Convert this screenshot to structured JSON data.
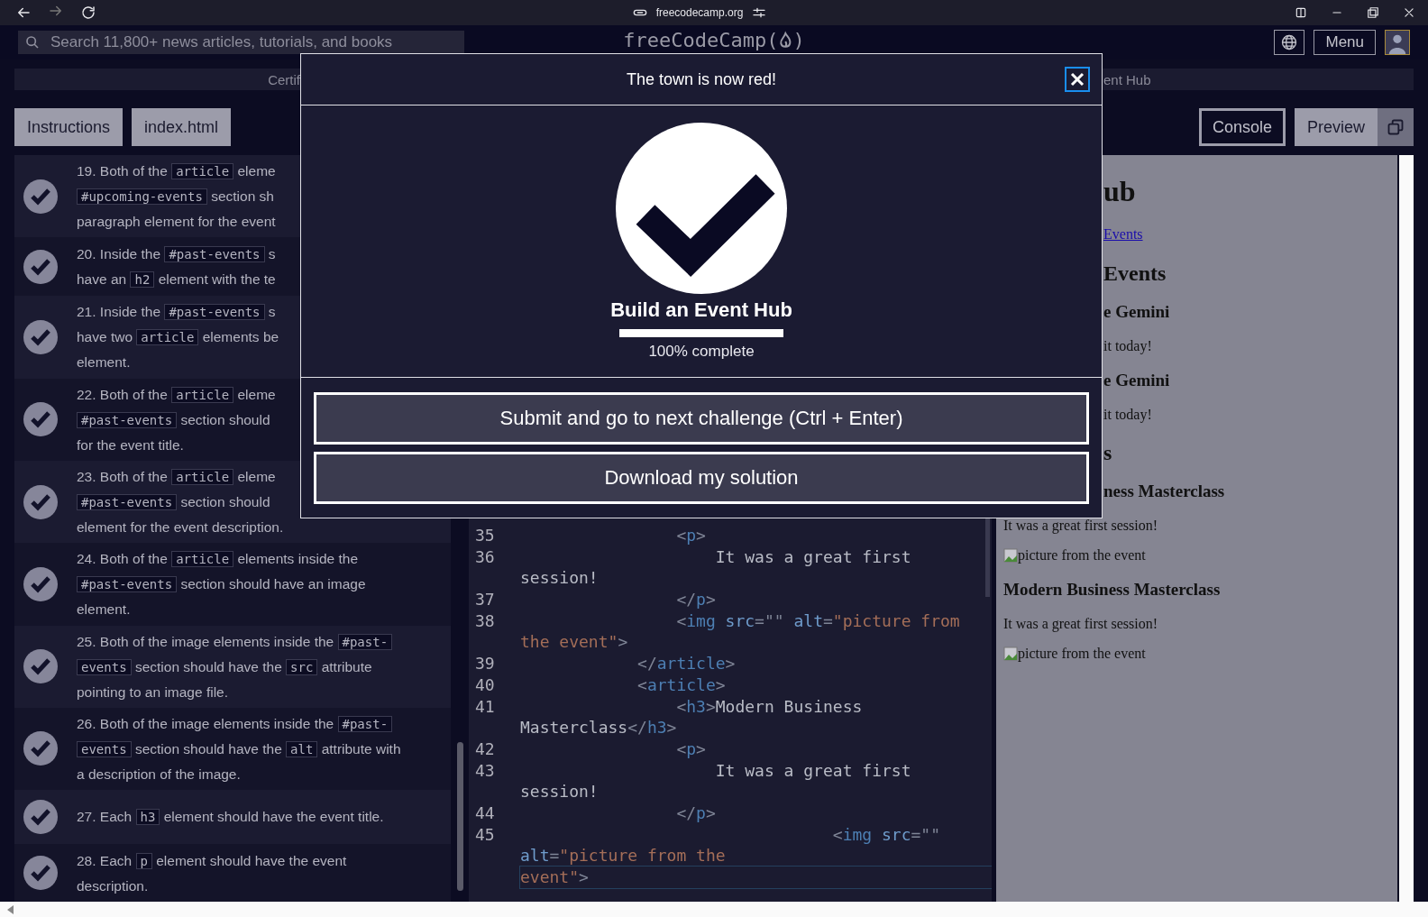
{
  "browser": {
    "url": "freecodecamp.org"
  },
  "nav": {
    "search": {
      "placeholder": "Search 11,800+ news articles, tutorials, and books"
    },
    "logo": {
      "before": "freeCodeCamp(",
      "after": ")"
    },
    "menu": "Menu"
  },
  "breadcrumb": {
    "left": "Certif",
    "right": "ent Hub"
  },
  "toolbar": {
    "tabs": [
      "Instructions",
      "index.html"
    ],
    "console": "Console",
    "preview": "Preview"
  },
  "tests": [
    {
      "passed": true,
      "lines": [
        [
          "19. Both of the ",
          {
            "code": "article"
          },
          " eleme"
        ],
        [
          {
            "code": "#upcoming-events"
          },
          " section sh"
        ],
        [
          "paragraph element for the event"
        ]
      ]
    },
    {
      "passed": true,
      "lines": [
        [
          "20. Inside the ",
          {
            "code": "#past-events"
          },
          " s"
        ],
        [
          "have an ",
          {
            "code": "h2"
          },
          " element with the te"
        ]
      ]
    },
    {
      "passed": true,
      "lines": [
        [
          "21. Inside the ",
          {
            "code": "#past-events"
          },
          " s"
        ],
        [
          "have two ",
          {
            "code": "article"
          },
          " elements be"
        ],
        [
          "element."
        ]
      ]
    },
    {
      "passed": true,
      "lines": [
        [
          "22. Both of the ",
          {
            "code": "article"
          },
          " eleme"
        ],
        [
          {
            "code": "#past-events"
          },
          " section should"
        ],
        [
          "for the event title."
        ]
      ]
    },
    {
      "passed": true,
      "lines": [
        [
          "23. Both of the ",
          {
            "code": "article"
          },
          " eleme"
        ],
        [
          {
            "code": "#past-events"
          },
          " section should"
        ],
        [
          "element for the event description."
        ]
      ]
    },
    {
      "passed": true,
      "lines": [
        [
          "24. Both of the ",
          {
            "code": "article"
          },
          " elements inside the"
        ],
        [
          {
            "code": "#past-events"
          },
          " section should have an image"
        ],
        [
          "element."
        ]
      ]
    },
    {
      "passed": true,
      "lines": [
        [
          "25. Both of the image elements inside the ",
          {
            "code": "#past-"
          }
        ],
        [
          {
            "code": "events"
          },
          " section should have the ",
          {
            "code": "src"
          },
          " attribute"
        ],
        [
          "pointing to an image file."
        ]
      ]
    },
    {
      "passed": true,
      "lines": [
        [
          "26. Both of the image elements inside the ",
          {
            "code": "#past-"
          }
        ],
        [
          {
            "code": "events"
          },
          " section should have the ",
          {
            "code": "alt"
          },
          " attribute with"
        ],
        [
          "a description of the image."
        ]
      ]
    },
    {
      "passed": true,
      "lines": [
        [
          "27. Each ",
          {
            "code": "h3"
          },
          " element should have the event title."
        ]
      ]
    },
    {
      "passed": true,
      "lines": [
        [
          "28. Each ",
          {
            "code": "p"
          },
          " element should have the event"
        ],
        [
          "description."
        ]
      ]
    }
  ],
  "editor": {
    "lines": [
      {
        "num": "35",
        "active": false,
        "rows": [
          [
            {
              "kind": "p",
              "t": "                <"
            },
            {
              "kind": "tag",
              "t": "p"
            },
            {
              "kind": "p",
              "t": ">"
            }
          ]
        ]
      },
      {
        "num": "36",
        "active": false,
        "rows": [
          [
            {
              "kind": "text",
              "t": "                    It was a great first"
            }
          ],
          [
            {
              "kind": "text",
              "t": "session!"
            }
          ]
        ]
      },
      {
        "num": "37",
        "active": false,
        "rows": [
          [
            {
              "kind": "p",
              "t": "                </"
            },
            {
              "kind": "tag",
              "t": "p"
            },
            {
              "kind": "p",
              "t": ">"
            }
          ]
        ]
      },
      {
        "num": "38",
        "active": false,
        "rows": [
          [
            {
              "kind": "p",
              "t": "                <"
            },
            {
              "kind": "tag",
              "t": "img"
            },
            {
              "kind": "attr",
              "t": " src"
            },
            {
              "kind": "p",
              "t": "=\"\""
            },
            {
              "kind": "attr",
              "t": " alt"
            },
            {
              "kind": "p",
              "t": "="
            },
            {
              "kind": "str",
              "t": "\"picture from"
            }
          ],
          [
            {
              "kind": "str",
              "t": "the event\""
            },
            {
              "kind": "p",
              "t": ">"
            }
          ]
        ]
      },
      {
        "num": "39",
        "active": false,
        "rows": [
          [
            {
              "kind": "p",
              "t": "            </"
            },
            {
              "kind": "tag",
              "t": "article"
            },
            {
              "kind": "p",
              "t": ">"
            }
          ]
        ]
      },
      {
        "num": "40",
        "active": false,
        "rows": [
          [
            {
              "kind": "p",
              "t": "            <"
            },
            {
              "kind": "tag",
              "t": "article"
            },
            {
              "kind": "p",
              "t": ">"
            }
          ]
        ]
      },
      {
        "num": "41",
        "active": false,
        "rows": [
          [
            {
              "kind": "p",
              "t": "                <"
            },
            {
              "kind": "tag",
              "t": "h3"
            },
            {
              "kind": "p",
              "t": ">"
            },
            {
              "kind": "text",
              "t": "Modern Business"
            }
          ],
          [
            {
              "kind": "text",
              "t": "Masterclass"
            },
            {
              "kind": "p",
              "t": "</"
            },
            {
              "kind": "tag",
              "t": "h3"
            },
            {
              "kind": "p",
              "t": ">"
            }
          ]
        ]
      },
      {
        "num": "42",
        "active": false,
        "rows": [
          [
            {
              "kind": "p",
              "t": "                <"
            },
            {
              "kind": "tag",
              "t": "p"
            },
            {
              "kind": "p",
              "t": ">"
            }
          ]
        ]
      },
      {
        "num": "43",
        "active": false,
        "rows": [
          [
            {
              "kind": "text",
              "t": "                    It was a great first"
            }
          ],
          [
            {
              "kind": "text",
              "t": "session!"
            }
          ]
        ]
      },
      {
        "num": "44",
        "active": false,
        "rows": [
          [
            {
              "kind": "p",
              "t": "                </"
            },
            {
              "kind": "tag",
              "t": "p"
            },
            {
              "kind": "p",
              "t": ">"
            }
          ]
        ]
      },
      {
        "num": "45",
        "active": true,
        "rows": [
          [
            {
              "kind": "p",
              "t": "                                <"
            },
            {
              "kind": "tag",
              "t": "img"
            },
            {
              "kind": "attr",
              "t": " src"
            },
            {
              "kind": "p",
              "t": "=\"\""
            }
          ],
          [
            {
              "kind": "attr",
              "t": "alt"
            },
            {
              "kind": "p",
              "t": "="
            },
            {
              "kind": "str",
              "t": "\"picture from the"
            }
          ],
          [
            {
              "kind": "str",
              "t": "event\""
            },
            {
              "kind": "p",
              "t": ">"
            }
          ]
        ]
      }
    ]
  },
  "preview": {
    "beside_dialog": [
      {
        "kind": "h1",
        "text": "ub"
      },
      {
        "kind": "link",
        "text": "Events"
      },
      {
        "kind": "h2",
        "text": "Events"
      },
      {
        "kind": "h3",
        "text": "e Gemini"
      },
      {
        "kind": "p",
        "text": "it today!"
      },
      {
        "kind": "h3",
        "text": "e Gemini"
      },
      {
        "kind": "p",
        "text": "it today!"
      },
      {
        "kind": "h2",
        "text": "s"
      },
      {
        "kind": "h3",
        "text": "ness Masterclass"
      }
    ],
    "below_dialog": [
      {
        "kind": "p",
        "text": "It was a great first session!"
      },
      {
        "kind": "img",
        "text": "picture from the event"
      },
      {
        "kind": "h3",
        "text": "Modern Business Masterclass"
      },
      {
        "kind": "p",
        "text": "It was a great first session!"
      },
      {
        "kind": "img",
        "text": "picture from the event"
      }
    ]
  },
  "dialog": {
    "title": "The town is now red!",
    "project": "Build an Event Hub",
    "progress": {
      "level": 1.0
    },
    "progress_text": "100% complete",
    "buttons": [
      "Submit and go to next challenge (Ctrl + Enter)",
      "Download my solution"
    ]
  }
}
